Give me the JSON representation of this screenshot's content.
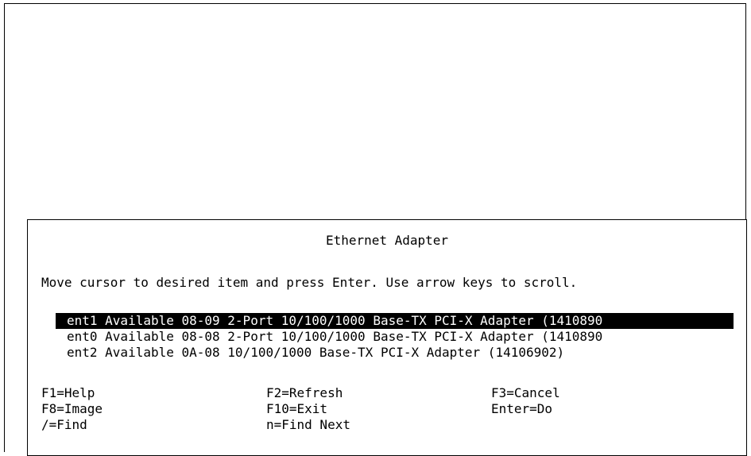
{
  "dialog": {
    "title": "Ethernet Adapter",
    "instruction": "Move cursor to desired item and press Enter. Use arrow keys to scroll.",
    "items": [
      {
        "label": "ent1 Available 08-09 2-Port 10/100/1000 Base-TX PCI-X Adapter (1410890",
        "selected": true
      },
      {
        "label": "ent0 Available 08-08 2-Port 10/100/1000 Base-TX PCI-X Adapter (1410890",
        "selected": false
      },
      {
        "label": "ent2 Available 0A-08 10/100/1000 Base-TX PCI-X Adapter (14106902)",
        "selected": false
      }
    ],
    "function_keys": {
      "help": "F1=Help",
      "refresh": "F2=Refresh",
      "cancel": "F3=Cancel",
      "image": "F8=Image",
      "exit": "F10=Exit",
      "do": "Enter=Do",
      "find": "/=Find",
      "find_next": "n=Find Next"
    }
  },
  "colors": {
    "background": "#ffffff",
    "foreground": "#000000",
    "selection_background": "#000000",
    "selection_foreground": "#ffffff"
  }
}
